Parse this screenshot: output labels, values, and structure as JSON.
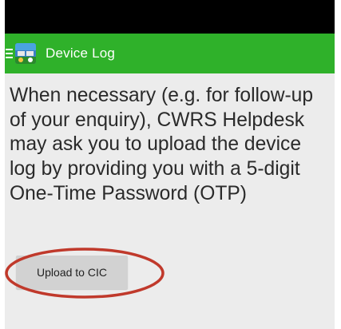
{
  "action_bar": {
    "title": "Device Log",
    "background": "#2fb12a"
  },
  "content": {
    "message": "When necessary (e.g. for follow-up of your enquiry), CWRS Helpdesk may ask you to upload the device log by providing you with a 5-digit One-Time Password (OTP)"
  },
  "buttons": {
    "upload_label": "Upload to CIC"
  },
  "annotation": {
    "color": "#c0392b"
  },
  "icons": {
    "menu": "hamburger-menu-icon",
    "app": "app-logo-icon"
  }
}
